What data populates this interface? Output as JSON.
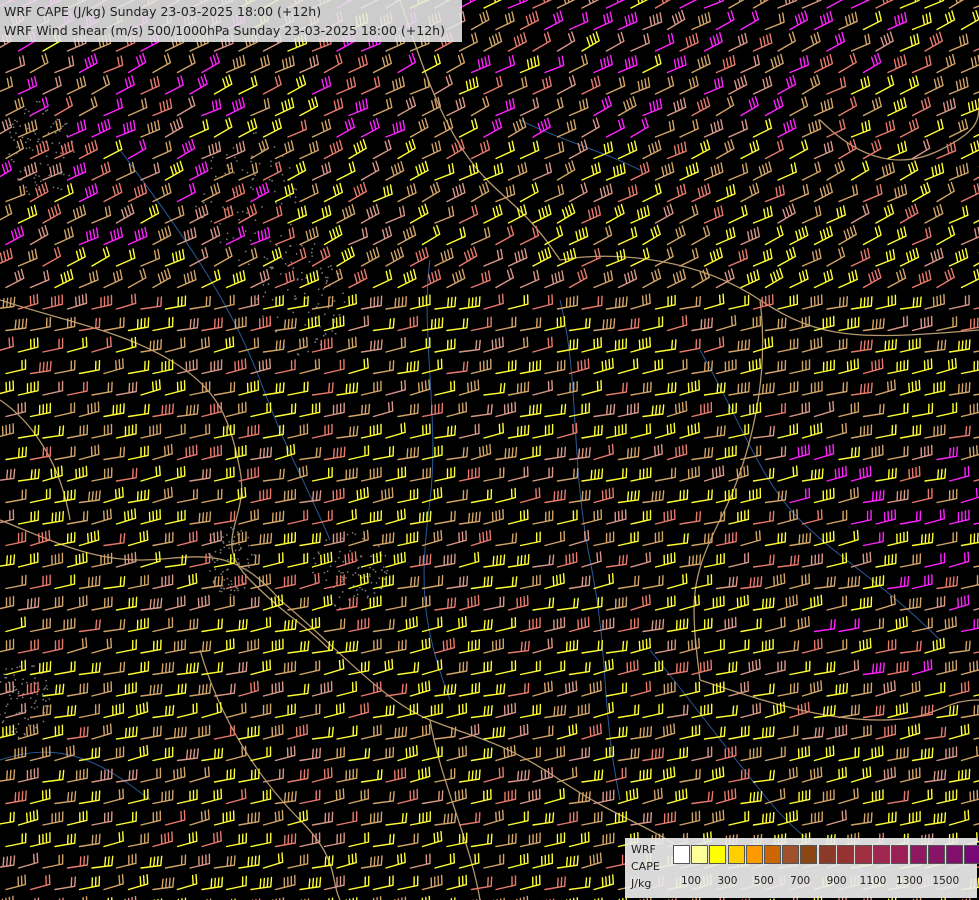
{
  "map": {
    "title_line1": "WRF CAPE (J/kg) Sunday 23-03-2025 18:00 (+12h)",
    "title_line2": "WRF Wind shear (m/s) 500/1000hPa Sunday 23-03-2025 18:00 (+12h)",
    "background_color": "#000000",
    "barb_colors": [
      "#ffff33",
      "#d2a468",
      "#e87a6c",
      "#ff22ff",
      "#d89888"
    ],
    "border_color": "#c8a878",
    "river_color": "#2a5a9a"
  },
  "legend": {
    "label_line1": "WRF",
    "label_line2": "CAPE",
    "label_line3": "J/kg",
    "colors": [
      "#ffffff",
      "#ffff99",
      "#ffff00",
      "#ffd000",
      "#ff9900",
      "#cc6600",
      "#a0502a",
      "#8b4513",
      "#8b3a2a",
      "#963232",
      "#a03040",
      "#a02850",
      "#9a2055",
      "#901860",
      "#881468",
      "#800f6e",
      "#780878",
      "#70007a"
    ],
    "tick_labels": [
      "100",
      "300",
      "500",
      "700",
      "900",
      "1100",
      "1300",
      "1500"
    ]
  }
}
